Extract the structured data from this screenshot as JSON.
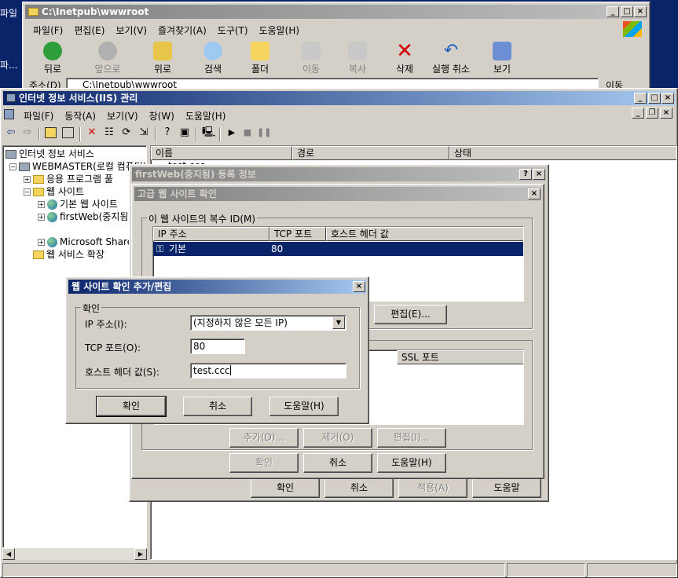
{
  "desktop": {
    "left_label_1": "파일",
    "left_label_2": "파..."
  },
  "explorer": {
    "title": "C:\\Inetpub\\wwwroot",
    "menu": [
      "파일(F)",
      "편집(E)",
      "보기(V)",
      "즐겨찾기(A)",
      "도구(T)",
      "도움말(H)"
    ],
    "toolbar": {
      "back": "뒤로",
      "forward": "앞으로",
      "up": "위로",
      "search": "검색",
      "folders": "폴더",
      "move": "이동",
      "copy": "복사",
      "delete": "삭제",
      "undo": "실행 취소",
      "views": "보기"
    },
    "address_label": "주소(D)",
    "address_value": "C:\\Inetpub\\wwwroot",
    "go_label": "이동"
  },
  "iis": {
    "title": "인터넷 정보 서비스(IIS) 관리",
    "menu": [
      "파일(F)",
      "동작(A)",
      "보기(V)",
      "창(W)",
      "도움말(H)"
    ],
    "tree": {
      "root": "인터넷 정보 서비스",
      "server": "WEBMASTER(로컬 컴퓨터)",
      "app_pools": "응용 프로그램 풀",
      "web_sites": "웹 사이트",
      "default_site": "기본 웹 사이트",
      "first_web": "firstWeb(중지됨)",
      "sharepoint": "Microsoft SharePoint",
      "extensions": "웹 서비스 확장"
    },
    "columns": [
      "이름",
      "경로",
      "상태"
    ],
    "first_row": "test.ccc"
  },
  "props": {
    "title": "firstWeb(중지됨) 등록 정보",
    "ok": "확인",
    "cancel": "취소",
    "apply": "적용(A)",
    "help": "도움말"
  },
  "advanced": {
    "title": "고급 웹 사이트 확인",
    "group_label": "이 웹 사이트의 복수 ID(M)",
    "columns": [
      "IP 주소",
      "TCP 포트",
      "호스트 헤더 값"
    ],
    "row": {
      "ip": "기본",
      "port": "80",
      "host": ""
    },
    "edit_button": "편집(E)...",
    "ssl_column": "SSL 포트",
    "add_button": "추가(D)...",
    "remove_button": "제거(O)",
    "edit2_button": "편집(I)...",
    "ok": "확인",
    "cancel": "취소",
    "help": "도움말(H)"
  },
  "edit_dialog": {
    "title": "웹 사이트 확인 추가/편집",
    "group_label": "확인",
    "ip_label": "IP 주소(I):",
    "ip_value": "(지정하지 않은 모든 IP)",
    "tcp_label": "TCP 포트(O):",
    "tcp_value": "80",
    "host_label": "호스트 헤더 값(S):",
    "host_value": "test.ccc",
    "ok": "확인",
    "cancel": "취소",
    "help": "도움말(H)"
  }
}
